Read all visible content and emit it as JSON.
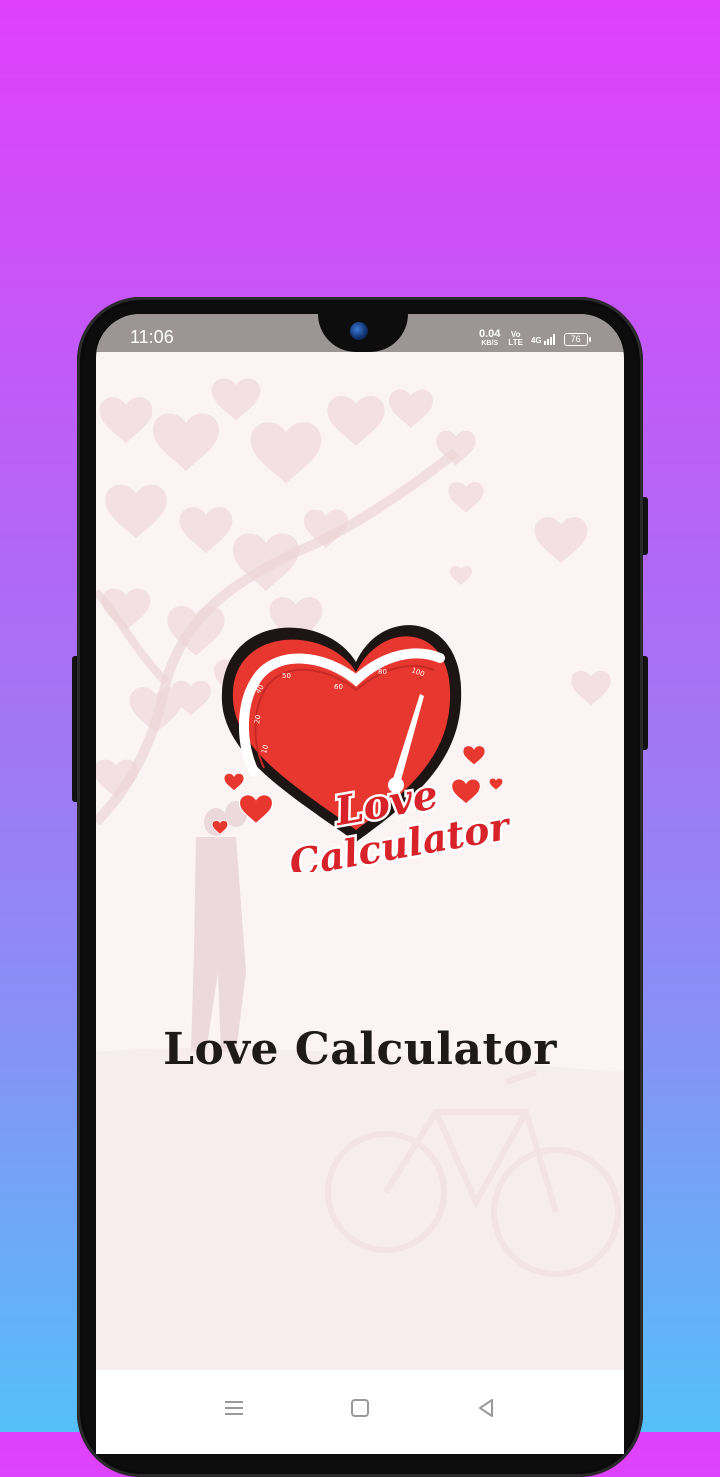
{
  "status_bar": {
    "time": "11:06",
    "net_speed_value": "0.04",
    "net_speed_unit": "KB/S",
    "volte_top": "Vo",
    "volte_bottom": "LTE",
    "network": "4G",
    "battery": "76"
  },
  "app": {
    "title": "Love Calculator",
    "logo_line1": "Love",
    "logo_line2": "Calculator",
    "gauge_ticks": [
      "10",
      "20",
      "40",
      "50",
      "60",
      "80",
      "100"
    ]
  },
  "icons": {
    "nav_menu": "menu-icon",
    "nav_home": "home-icon",
    "nav_back": "back-icon"
  },
  "colors": {
    "heart_red": "#e8372f",
    "logo_text": "#d8232a",
    "background_top": "#e040fb",
    "background_bottom": "#55bff8"
  }
}
